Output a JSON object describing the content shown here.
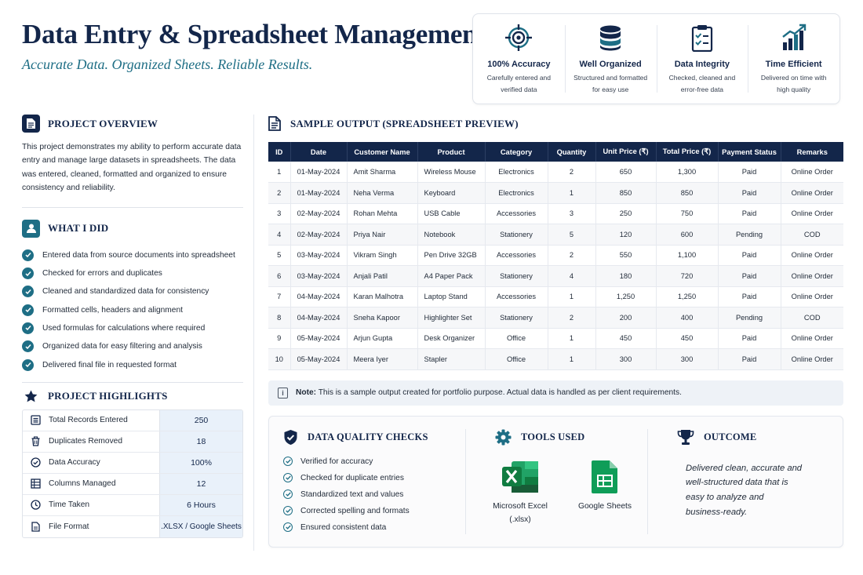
{
  "header": {
    "title": "Data Entry & Spreadsheet Management",
    "subtitle": "Accurate Data. Organized Sheets. Reliable Results."
  },
  "features": [
    {
      "icon": "target-icon",
      "title": "100% Accuracy",
      "desc": "Carefully entered and verified data"
    },
    {
      "icon": "database-icon",
      "title": "Well Organized",
      "desc": "Structured and formatted for easy use"
    },
    {
      "icon": "clipboard-check-icon",
      "title": "Data Integrity",
      "desc": "Checked, cleaned and error-free data"
    },
    {
      "icon": "growth-chart-icon",
      "title": "Time Efficient",
      "desc": "Delivered on time with high quality"
    }
  ],
  "overview": {
    "title": "PROJECT OVERVIEW",
    "text": "This project demonstrates my ability to perform accurate data entry and manage large datasets in spreadsheets. The data was entered, cleaned, formatted and organized to ensure consistency and reliability."
  },
  "what_i_did": {
    "title": "WHAT I DID",
    "items": [
      "Entered data from source documents into spreadsheet",
      "Checked for errors and duplicates",
      "Cleaned and standardized data for consistency",
      "Formatted cells, headers and alignment",
      "Used formulas for calculations where required",
      "Organized data for easy filtering and analysis",
      "Delivered final file in requested format"
    ]
  },
  "highlights": {
    "title": "PROJECT HIGHLIGHTS",
    "rows": [
      {
        "icon": "document-list-icon",
        "label": "Total Records Entered",
        "value": "250"
      },
      {
        "icon": "trash-icon",
        "label": "Duplicates Removed",
        "value": "18"
      },
      {
        "icon": "check-circle-icon",
        "label": "Data Accuracy",
        "value": "100%"
      },
      {
        "icon": "columns-icon",
        "label": "Columns Managed",
        "value": "12"
      },
      {
        "icon": "clock-icon",
        "label": "Time Taken",
        "value": "6 Hours"
      },
      {
        "icon": "file-icon",
        "label": "File Format",
        "value": ".XLSX / Google Sheets"
      }
    ]
  },
  "sample": {
    "title": "SAMPLE OUTPUT (SPREADSHEET PREVIEW)",
    "headers": [
      "ID",
      "Date",
      "Customer Name",
      "Product",
      "Category",
      "Quantity",
      "Unit Price (₹)",
      "Total Price (₹)",
      "Payment Status",
      "Remarks"
    ],
    "rows": [
      [
        "1",
        "01-May-2024",
        "Amit Sharma",
        "Wireless Mouse",
        "Electronics",
        "2",
        "650",
        "1,300",
        "Paid",
        "Online Order"
      ],
      [
        "2",
        "01-May-2024",
        "Neha Verma",
        "Keyboard",
        "Electronics",
        "1",
        "850",
        "850",
        "Paid",
        "Online Order"
      ],
      [
        "3",
        "02-May-2024",
        "Rohan Mehta",
        "USB Cable",
        "Accessories",
        "3",
        "250",
        "750",
        "Paid",
        "Online Order"
      ],
      [
        "4",
        "02-May-2024",
        "Priya Nair",
        "Notebook",
        "Stationery",
        "5",
        "120",
        "600",
        "Pending",
        "COD"
      ],
      [
        "5",
        "03-May-2024",
        "Vikram Singh",
        "Pen Drive 32GB",
        "Accessories",
        "2",
        "550",
        "1,100",
        "Paid",
        "Online Order"
      ],
      [
        "6",
        "03-May-2024",
        "Anjali Patil",
        "A4 Paper Pack",
        "Stationery",
        "4",
        "180",
        "720",
        "Paid",
        "Online Order"
      ],
      [
        "7",
        "04-May-2024",
        "Karan Malhotra",
        "Laptop Stand",
        "Accessories",
        "1",
        "1,250",
        "1,250",
        "Paid",
        "Online Order"
      ],
      [
        "8",
        "04-May-2024",
        "Sneha Kapoor",
        "Highlighter Set",
        "Stationery",
        "2",
        "200",
        "400",
        "Pending",
        "COD"
      ],
      [
        "9",
        "05-May-2024",
        "Arjun Gupta",
        "Desk Organizer",
        "Office",
        "1",
        "450",
        "450",
        "Paid",
        "Online Order"
      ],
      [
        "10",
        "05-May-2024",
        "Meera Iyer",
        "Stapler",
        "Office",
        "1",
        "300",
        "300",
        "Paid",
        "Online Order"
      ]
    ]
  },
  "note": {
    "label": "Note:",
    "text": "This is a sample output created for portfolio purpose. Actual data is handled as per client requirements."
  },
  "quality": {
    "title": "DATA QUALITY CHECKS",
    "items": [
      "Verified for accuracy",
      "Checked for duplicate entries",
      "Standardized text and values",
      "Corrected spelling and formats",
      "Ensured consistent data"
    ]
  },
  "tools": {
    "title": "TOOLS USED",
    "items": [
      {
        "icon": "excel-icon",
        "name": "Microsoft Excel",
        "ext": "(.xlsx)"
      },
      {
        "icon": "google-sheets-icon",
        "name": "Google Sheets",
        "ext": ""
      }
    ]
  },
  "outcome": {
    "title": "OUTCOME",
    "text": "Delivered clean, accurate and well-structured data that is easy to analyze and business-ready."
  },
  "colors": {
    "navy": "#13264a",
    "teal": "#1e6e85",
    "highlight_bg": "#e9f1fa",
    "excel_green": "#1d6f42",
    "sheets_green": "#0f9d58"
  }
}
